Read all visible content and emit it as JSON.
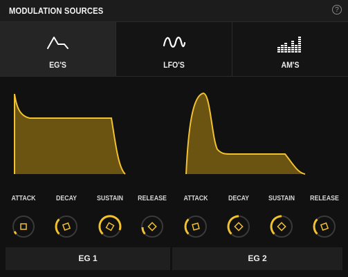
{
  "header": {
    "title": "MODULATION SOURCES",
    "help_glyph": "?"
  },
  "tabs": [
    {
      "label": "EG'S",
      "icon": "envelope-icon",
      "active": true
    },
    {
      "label": "LFO'S",
      "icon": "sine-wave-icon",
      "active": false
    },
    {
      "label": "AM'S",
      "icon": "bar-meter-icon",
      "active": false
    }
  ],
  "eg1": {
    "knobs": [
      "ATTACK",
      "DECAY",
      "SUSTAIN",
      "RELEASE"
    ],
    "button": "EG 1"
  },
  "eg2": {
    "knobs": [
      "ATTACK",
      "DECAY",
      "SUSTAIN",
      "RELEASE"
    ],
    "button": "EG 2"
  },
  "colors": {
    "accent": "#f2c230",
    "fill": "#6b5312",
    "knob_track": "#3a3a3a",
    "background": "#111111"
  }
}
